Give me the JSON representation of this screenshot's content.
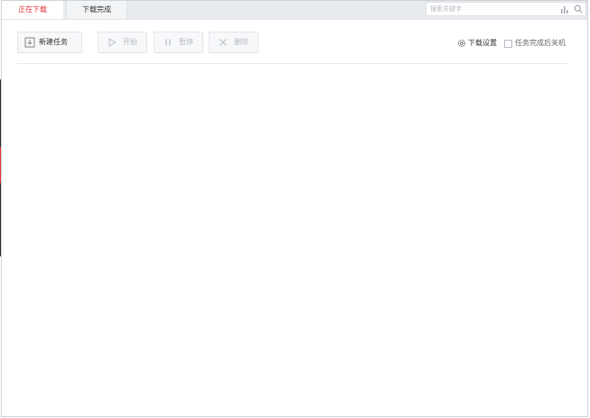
{
  "tabs": [
    {
      "label": "正在下载",
      "active": true
    },
    {
      "label": "下载完成",
      "active": false
    }
  ],
  "search": {
    "placeholder": "搜索关键字",
    "value": ""
  },
  "toolbar": {
    "new_task": "新建任务",
    "start": "开始",
    "pause": "暂停",
    "delete": "删除"
  },
  "settings": {
    "download_settings": "下载设置",
    "shutdown_on_complete": "任务完成后关机",
    "shutdown_checked": false
  },
  "colors": {
    "accent": "#e8333a",
    "disabled": "#b5b9be",
    "tabbar_bg": "#e9ecef"
  },
  "icons": {
    "new_task": "download-box-icon",
    "start": "play-icon",
    "pause": "pause-icon",
    "delete": "close-icon",
    "settings": "gear-icon",
    "search": "search-icon",
    "stats": "bar-chart-icon"
  }
}
